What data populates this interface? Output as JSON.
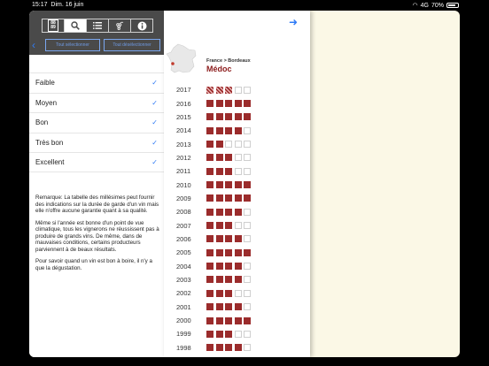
{
  "status_bar": {
    "time": "15:17",
    "date": "Dim. 16 juin",
    "network": "4G",
    "battery": "70%"
  },
  "toolbar": {
    "icons": [
      "vintage-chart-icon",
      "search-icon",
      "list-icon",
      "grapes-icon",
      "info-icon"
    ],
    "vintage_label": "88 89"
  },
  "nav": {
    "tout_selectionner": "Tout sélectionner",
    "tout_deselectionner": "Tout désélectionner"
  },
  "quality_filters": [
    {
      "label": "Faible",
      "checked": true
    },
    {
      "label": "Moyen",
      "checked": true
    },
    {
      "label": "Bon",
      "checked": true
    },
    {
      "label": "Très bon",
      "checked": true
    },
    {
      "label": "Excellent",
      "checked": true
    }
  ],
  "notes": [
    "Remarque: La tabelle des millésimes peut fournir des indications sur la durée de garde d'un vin mais elle n'offre aucune garantie quant à sa qualité.",
    "Même si l'année est bonne d'un point de vue climatique, tous les vignerons ne réussissent pas à produire de grands vins. De même, dans de mauvaises conditions, certains producteurs parviennent à de beaux résultats.",
    "Pour savoir quand un vin est bon à boire, il n'y a que la dégustation."
  ],
  "region": {
    "path": "France > Bordeaux",
    "name": "Médoc"
  },
  "colors": {
    "accent": "#2f7bf6",
    "wine": "#9b2c2c",
    "region_title": "#8b1a1a"
  },
  "vintages": [
    {
      "year": "2017",
      "filled": 3,
      "hatched": true
    },
    {
      "year": "2016",
      "filled": 5
    },
    {
      "year": "2015",
      "filled": 5
    },
    {
      "year": "2014",
      "filled": 4
    },
    {
      "year": "2013",
      "filled": 2
    },
    {
      "year": "2012",
      "filled": 3
    },
    {
      "year": "2011",
      "filled": 3
    },
    {
      "year": "2010",
      "filled": 5
    },
    {
      "year": "2009",
      "filled": 5
    },
    {
      "year": "2008",
      "filled": 4
    },
    {
      "year": "2007",
      "filled": 3
    },
    {
      "year": "2006",
      "filled": 4
    },
    {
      "year": "2005",
      "filled": 5
    },
    {
      "year": "2004",
      "filled": 4
    },
    {
      "year": "2003",
      "filled": 4
    },
    {
      "year": "2002",
      "filled": 3
    },
    {
      "year": "2001",
      "filled": 4
    },
    {
      "year": "2000",
      "filled": 5
    },
    {
      "year": "1999",
      "filled": 3
    },
    {
      "year": "1998",
      "filled": 4
    }
  ]
}
